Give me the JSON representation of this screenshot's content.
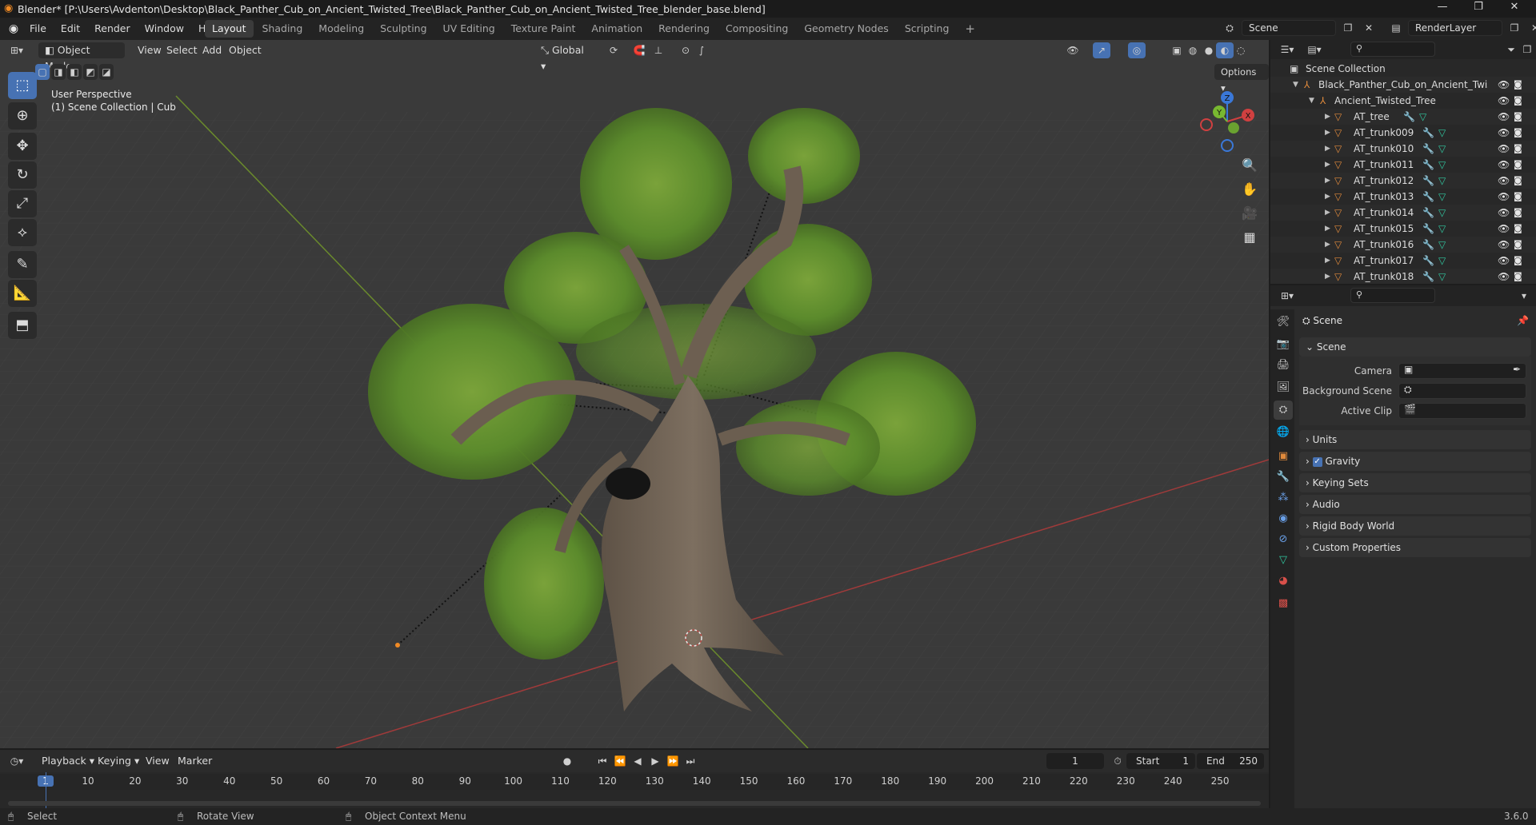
{
  "window": {
    "title": "Blender* [P:\\Users\\Avdenton\\Desktop\\Black_Panther_Cub_on_Ancient_Twisted_Tree\\Black_Panther_Cub_on_Ancient_Twisted_Tree_blender_base.blend]",
    "minimize": "—",
    "maximize": "❐",
    "close": "✕"
  },
  "menubar": {
    "menus": [
      "File",
      "Edit",
      "Render",
      "Window",
      "Help"
    ],
    "workspaces": [
      "Layout",
      "Shading",
      "Modeling",
      "Sculpting",
      "UV Editing",
      "Texture Paint",
      "Animation",
      "Rendering",
      "Compositing",
      "Geometry Nodes",
      "Scripting"
    ],
    "active_workspace": "Layout",
    "add_workspace": "+",
    "scene_name": "Scene",
    "view_layer": "RenderLayer"
  },
  "viewport": {
    "mode": "Object Mode",
    "menus": [
      "View",
      "Select",
      "Add",
      "Object"
    ],
    "orientation": "Global",
    "perspective_label": "User Perspective",
    "collection_label": "(1) Scene Collection | Cub",
    "options_label": "Options",
    "gizmo": {
      "x": "X",
      "y": "Y",
      "z": "Z"
    }
  },
  "outliner": {
    "root": "Scene Collection",
    "collection": "Black_Panther_Cub_on_Ancient_Twistec",
    "subcollection": "Ancient_Twisted_Tree",
    "objects": [
      "AT_tree",
      "AT_trunk009",
      "AT_trunk010",
      "AT_trunk011",
      "AT_trunk012",
      "AT_trunk013",
      "AT_trunk014",
      "AT_trunk015",
      "AT_trunk016",
      "AT_trunk017",
      "AT_trunk018"
    ]
  },
  "properties": {
    "context": "Scene",
    "panel_scene": "Scene",
    "camera_label": "Camera",
    "background_scene_label": "Background Scene",
    "active_clip_label": "Active Clip",
    "panels": [
      "Units",
      "Gravity",
      "Keying Sets",
      "Audio",
      "Rigid Body World",
      "Custom Properties"
    ],
    "gravity_checked": true
  },
  "timeline": {
    "menus": [
      "Playback",
      "Keying",
      "View",
      "Marker"
    ],
    "current_frame": "1",
    "start_label": "Start",
    "start": "1",
    "end_label": "End",
    "end": "250",
    "ticks": [
      "1",
      "10",
      "20",
      "30",
      "40",
      "50",
      "60",
      "70",
      "80",
      "90",
      "100",
      "110",
      "120",
      "130",
      "140",
      "150",
      "160",
      "170",
      "180",
      "190",
      "200",
      "210",
      "220",
      "230",
      "240",
      "250"
    ]
  },
  "statusbar": {
    "select": "Select",
    "rotate": "Rotate View",
    "context_menu": "Object Context Menu",
    "version": "3.6.0"
  }
}
